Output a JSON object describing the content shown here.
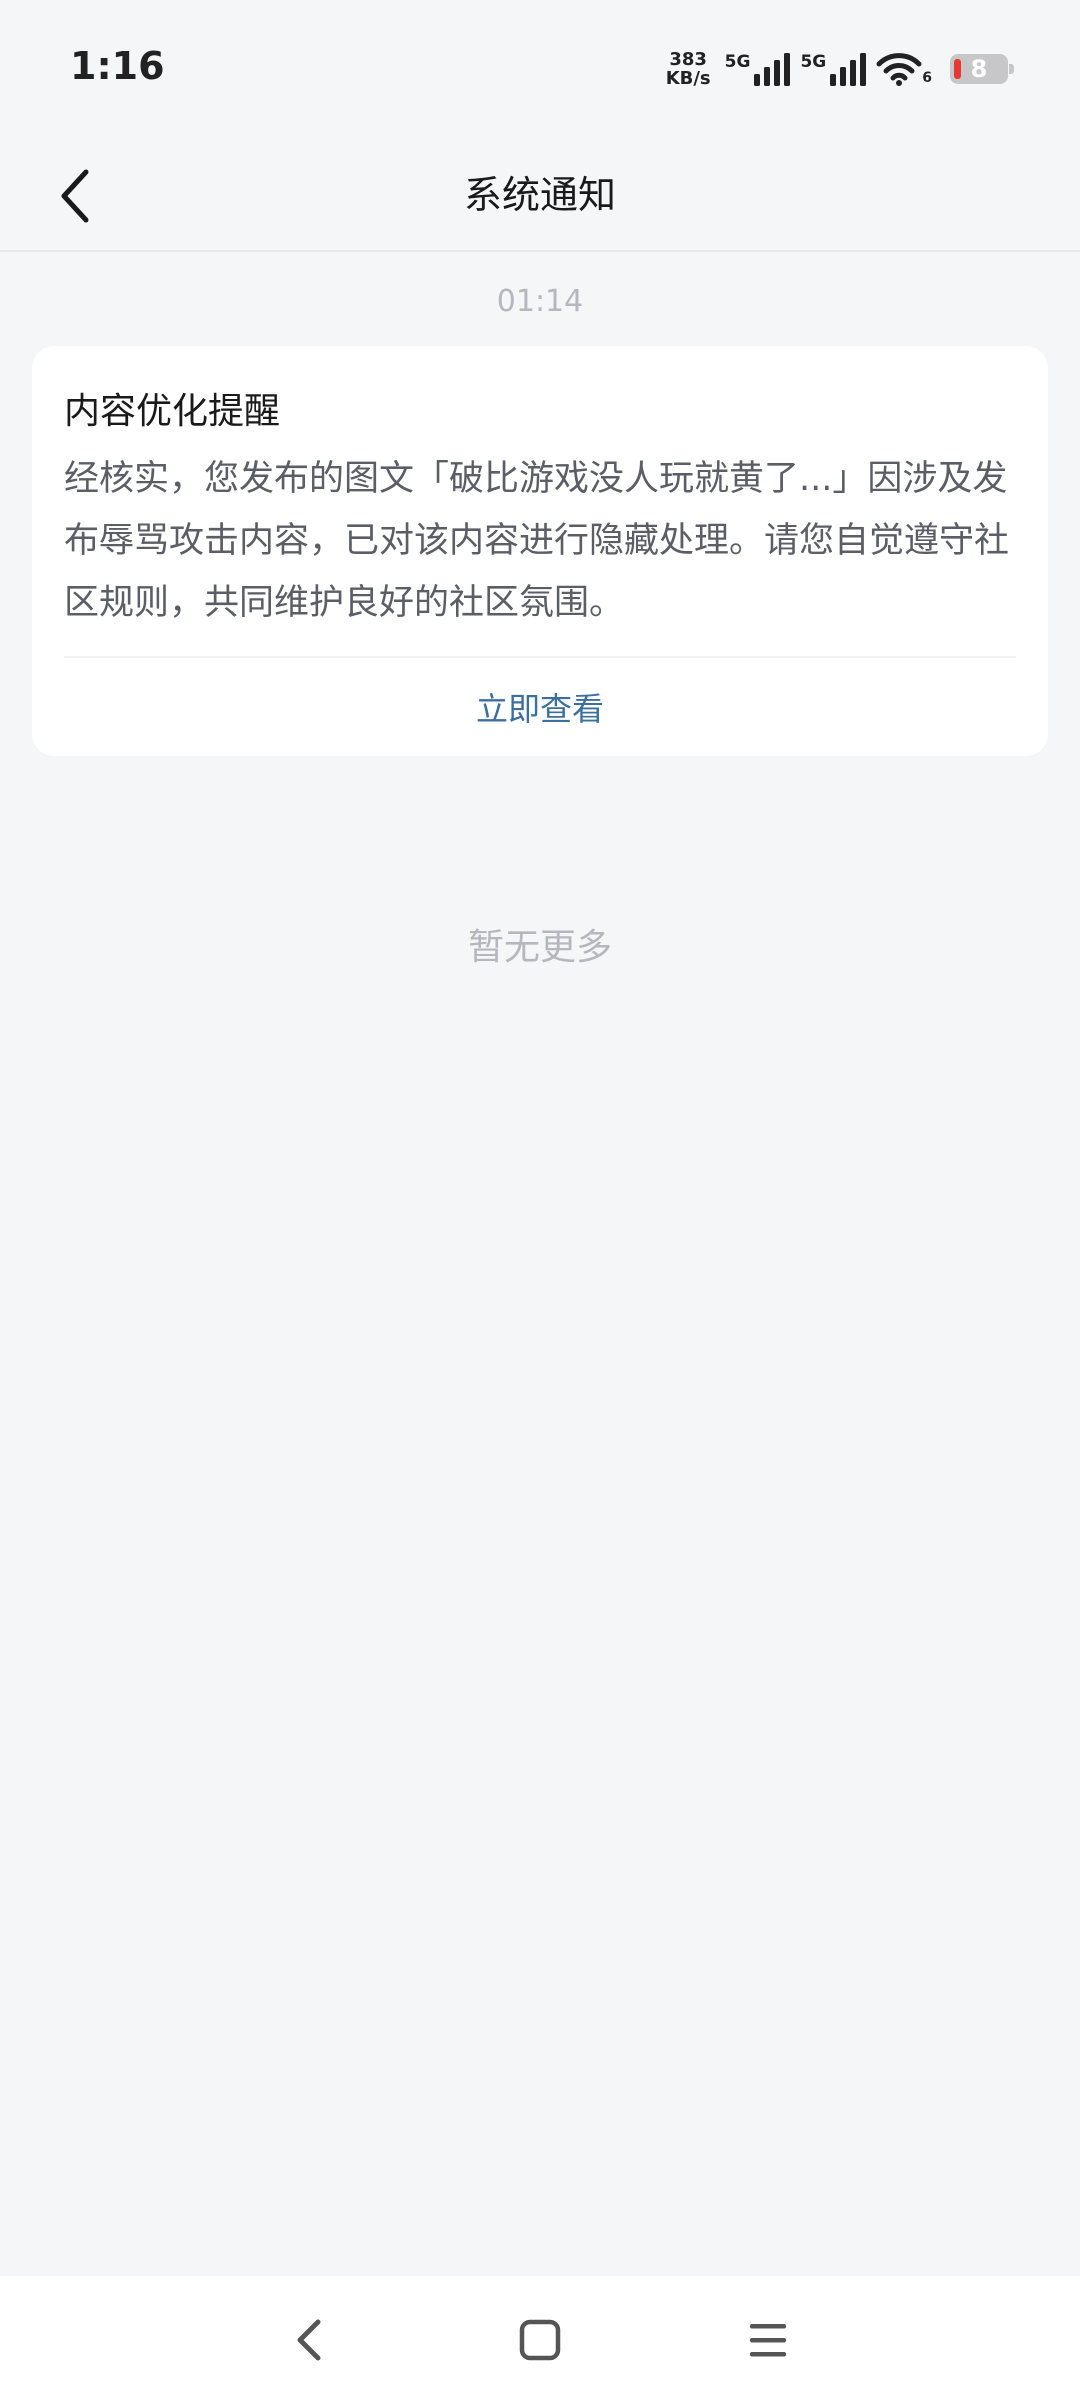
{
  "status_bar": {
    "time": "1:16",
    "net_speed_value": "383",
    "net_speed_unit": "KB/s",
    "signal1_label": "5G",
    "signal2_label": "5G",
    "wifi_badge": "6",
    "battery_level": "8"
  },
  "header": {
    "title": "系统通知"
  },
  "messages": [
    {
      "time": "01:14",
      "title": "内容优化提醒",
      "body": "经核实，您发布的图文「破比游戏没人玩就黄了...」因涉及发布辱骂攻击内容，已对该内容进行隐藏处理。请您自觉遵守社区规则，共同维护良好的社区氛围。",
      "action_label": "立即查看"
    }
  ],
  "footer": {
    "no_more_text": "暂无更多"
  },
  "colors": {
    "background": "#f5f6f8",
    "card": "#ffffff",
    "link": "#3b6fa0",
    "muted": "#b4b7bd",
    "battery_low": "#e53935"
  },
  "icons": {
    "back": "chevron-left-icon",
    "signal": "signal-bars-icon",
    "wifi": "wifi-icon",
    "battery": "battery-icon",
    "sys_back": "nav-back-icon",
    "sys_home": "nav-home-icon",
    "sys_menu": "nav-menu-icon"
  }
}
